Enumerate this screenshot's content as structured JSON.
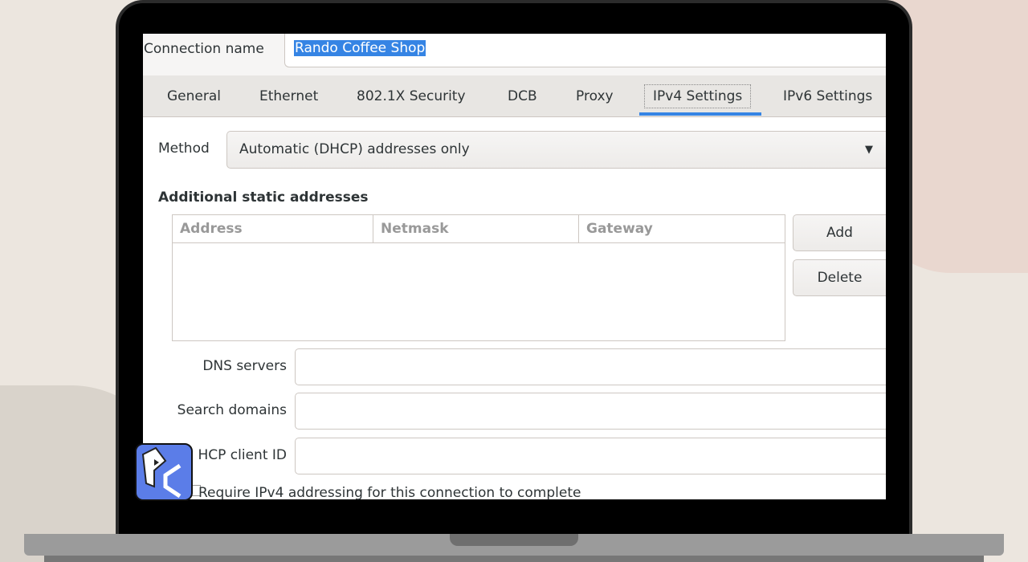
{
  "dialog": {
    "connection_name_label": "Connection name",
    "connection_name_value": "Rando Coffee Shop",
    "tabs": [
      {
        "label": "General"
      },
      {
        "label": "Ethernet"
      },
      {
        "label": "802.1X Security"
      },
      {
        "label": "DCB"
      },
      {
        "label": "Proxy"
      },
      {
        "label": "IPv4 Settings",
        "active": true
      },
      {
        "label": "IPv6 Settings"
      }
    ],
    "method_label": "Method",
    "method_value": "Automatic (DHCP) addresses only",
    "static_heading": "Additional static addresses",
    "columns": [
      "Address",
      "Netmask",
      "Gateway"
    ],
    "add_label": "Add",
    "delete_label": "Delete",
    "dns_label": "DNS servers",
    "search_label": "Search domains",
    "dhcp_label": "HCP client ID",
    "require_label": "Require IPv4 addressing for this connection to complete"
  },
  "logo": {
    "text": "PC"
  },
  "colors": {
    "accent": "#3584e4"
  }
}
